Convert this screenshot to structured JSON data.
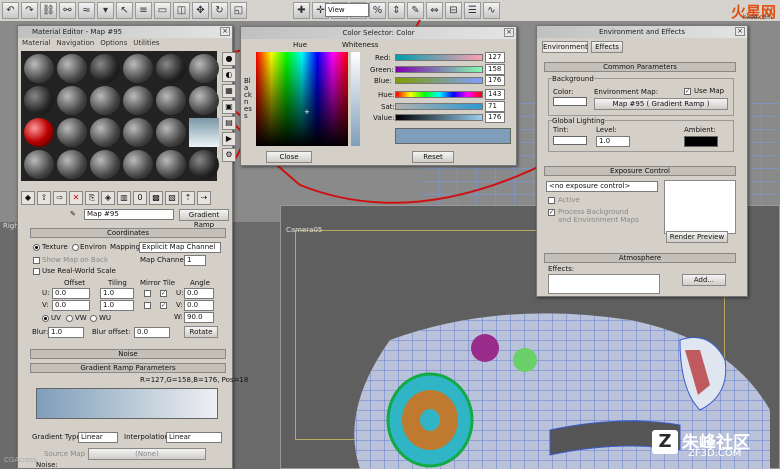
{
  "toolbar": {
    "view_select": "View"
  },
  "brand_top": {
    "logo": "火星网",
    "sub": "hxsd.com"
  },
  "viewport": {
    "right_label": "Right",
    "camera_label": "Camera05"
  },
  "material_editor": {
    "title": "Material Editor - Map #95",
    "menu": [
      "Material",
      "Navigation",
      "Options",
      "Utilities"
    ],
    "map_name": "Map #95",
    "map_type_button": "Gradient Ramp",
    "coordinates": {
      "header": "Coordinates",
      "texture": "Texture",
      "environ": "Environ",
      "mapping_label": "Mapping:",
      "mapping_value": "Explicit Map Channel",
      "show_map_on_back": "Show Map on Back",
      "map_channel_label": "Map Channel:",
      "map_channel_value": "1",
      "use_real_world_scale": "Use Real-World Scale",
      "col_offset": "Offset",
      "col_tiling": "Tiling",
      "col_mirror_tile": "Mirror Tile",
      "col_angle": "Angle",
      "u": "U:",
      "v": "V:",
      "w": "W:",
      "u_offset": "0.0",
      "v_offset": "0.0",
      "u_tiling": "1.0",
      "v_tiling": "1.0",
      "u_angle": "0.0",
      "v_angle": "0.0",
      "w_angle": "90.0",
      "uv": "UV",
      "vw": "VW",
      "wu": "WU",
      "blur_label": "Blur:",
      "blur_value": "1.0",
      "blur_offset_label": "Blur offset:",
      "blur_offset_value": "0.0",
      "rotate": "Rotate"
    },
    "noise_header": "Noise",
    "gradient_header": "Gradient Ramp Parameters",
    "gradient_readout": "R=127,G=158,B=176, Pos=18",
    "gradient_type_label": "Gradient Type:",
    "gradient_type": "Linear",
    "interpolation_label": "Interpolation:",
    "interpolation": "Linear",
    "source_map_label": "Source Map",
    "source_map_value": "(None)",
    "noise_sub": "Noise:",
    "watermark": "CGAcross"
  },
  "color_selector": {
    "title": "Color Selector: Color",
    "hue_label": "Hue",
    "whiteness_label": "Whiteness",
    "blackness_label": "Blackness",
    "red_label": "Red:",
    "red": "127",
    "green_label": "Green:",
    "green": "158",
    "blue_label": "Blue:",
    "blue": "176",
    "hue_field_label": "Hue:",
    "hue": "143",
    "sat_label": "Sat:",
    "sat": "71",
    "value_label": "Value:",
    "value": "176",
    "close": "Close",
    "reset": "Reset",
    "swatch_color": "#7f9eba"
  },
  "environment": {
    "title": "Environment and Effects",
    "tab_environment": "Environment",
    "tab_effects": "Effects",
    "common_params": "Common Parameters",
    "background_group": "Background",
    "color_label": "Color:",
    "env_map_label": "Environment Map:",
    "use_map": "Use Map",
    "env_map_button": "Map #95  ( Gradient Ramp )",
    "global_lighting": "Global Lighting",
    "tint_label": "Tint:",
    "level_label": "Level:",
    "level_value": "1.0",
    "ambient_label": "Ambient:",
    "exposure_header": "Exposure Control",
    "exposure_value": "<no exposure control>",
    "active": "Active",
    "process_bg": "Process Background",
    "process_bg2": "and Environment Maps",
    "render_preview": "Render Preview",
    "atmosphere_header": "Atmosphere",
    "effects_label": "Effects:",
    "add_button": "Add..."
  },
  "brand_bottom": {
    "logo": "朱峰社区",
    "sub": "ZF3D.COM"
  }
}
